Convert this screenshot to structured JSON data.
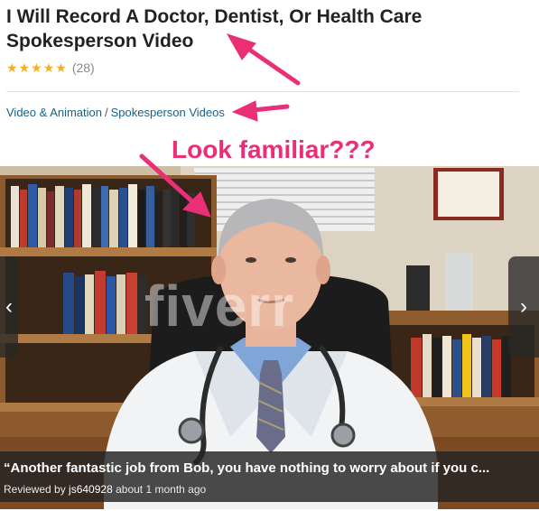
{
  "gig": {
    "title": "I Will Record A Doctor, Dentist, Or Health Care Spokesperson Video",
    "rating": {
      "stars": 5,
      "count": "(28)"
    }
  },
  "breadcrumb": {
    "category": "Video & Animation",
    "separator": "/",
    "subcategory": "Spokesperson Videos"
  },
  "annotation": {
    "text": "Look familiar???",
    "color": "#ea2f76"
  },
  "gallery": {
    "watermark": "fiverr",
    "prev_icon": "‹",
    "next_icon": "›",
    "review": {
      "quote": "“Another fantastic job from Bob, you have nothing to worry about if you c...",
      "prefix": "Reviewed by",
      "user": "js640928",
      "time": "about 1 month ago"
    }
  },
  "colors": {
    "star": "#f6b01e",
    "link": "#1a5f86",
    "title": "#222222"
  }
}
